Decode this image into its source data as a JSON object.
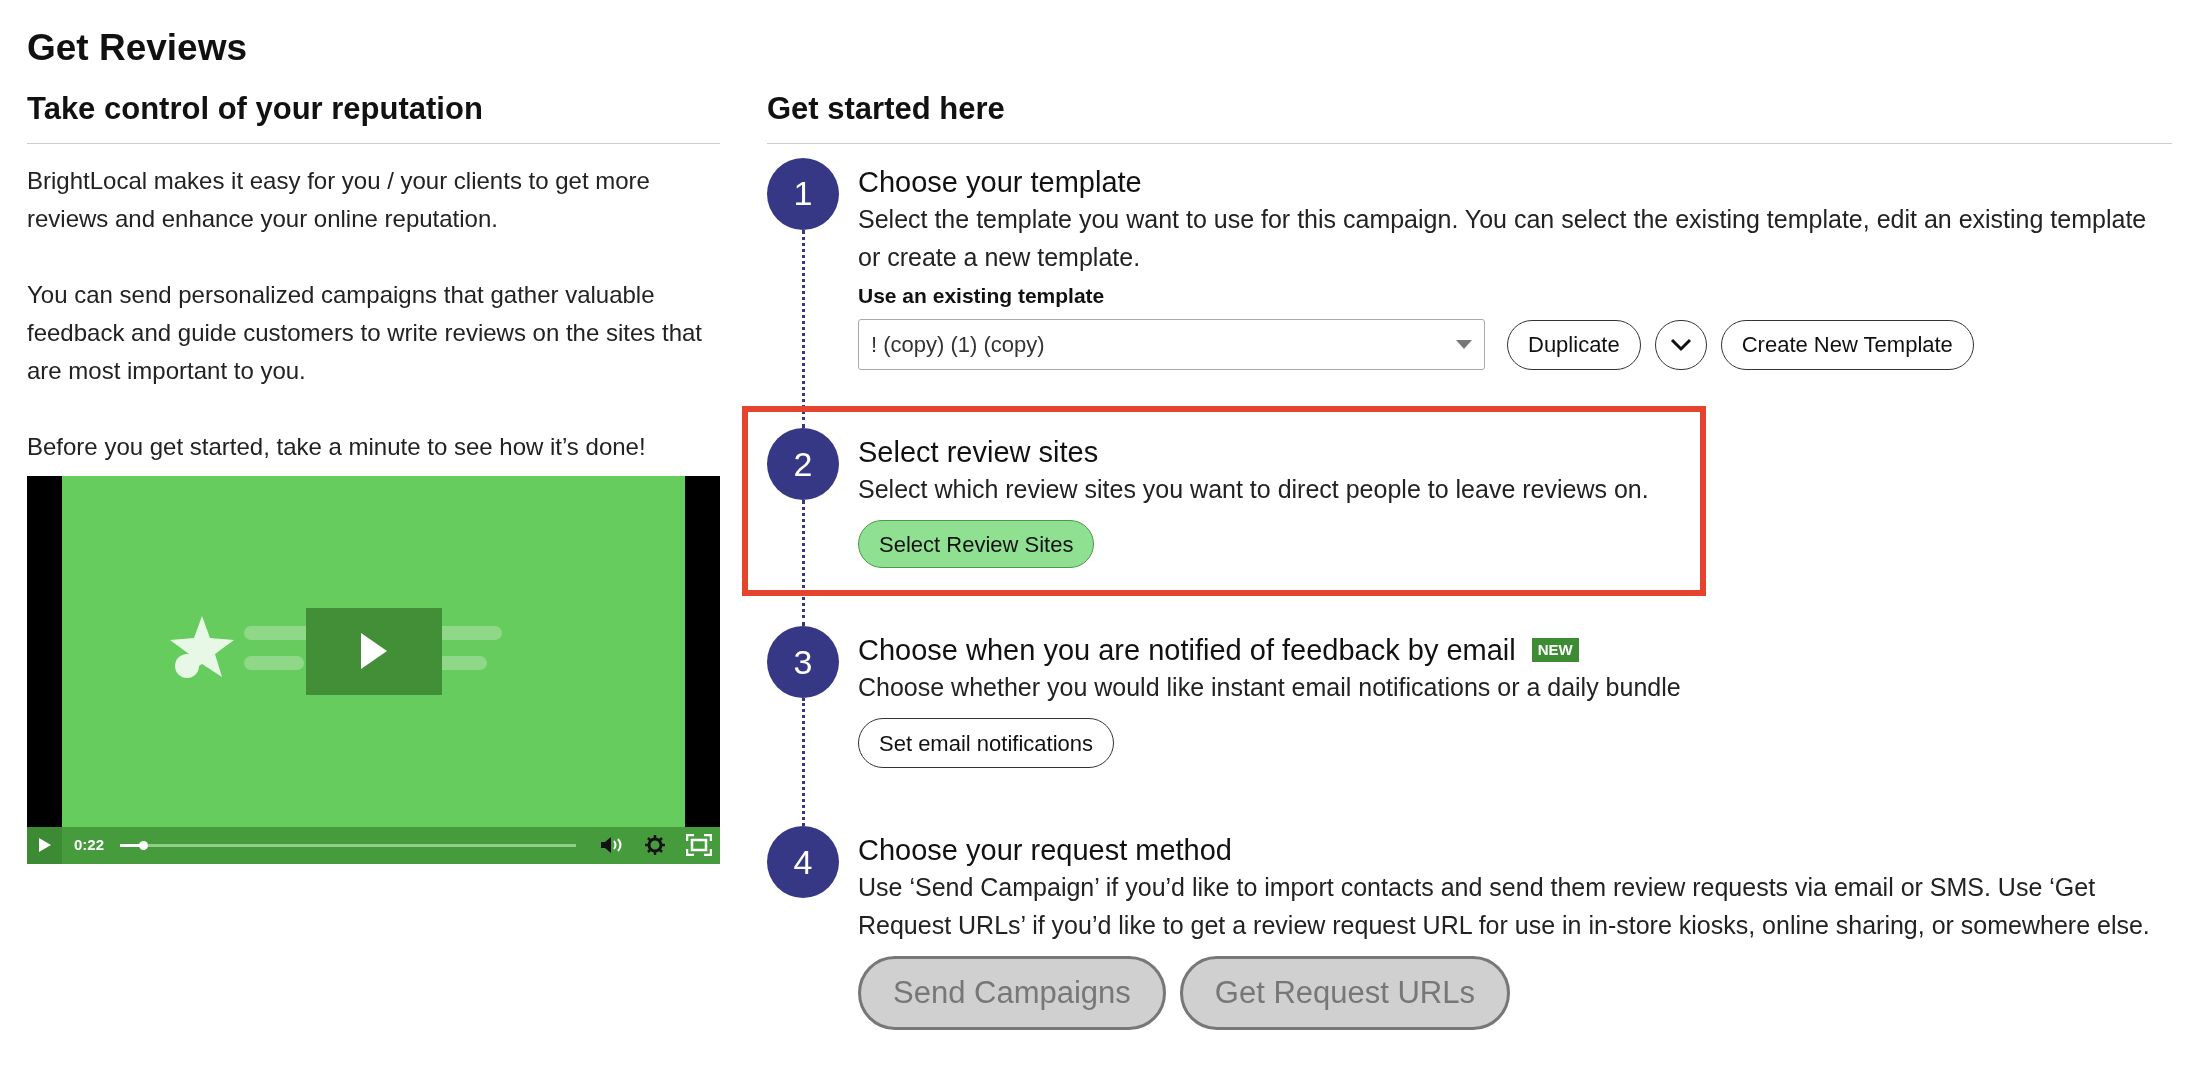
{
  "page_title": "Get Reviews",
  "intro": {
    "heading": "Take control of your reputation",
    "paragraphs": [
      "BrightLocal makes it easy for you / your clients to get more reviews and enhance your online reputation.",
      "You can send personalized campaigns that gather valuable feedback and guide customers to write reviews on the sites that are most important to you.",
      "Before you get started, take a minute to see how it’s done!"
    ],
    "video": {
      "playing": false,
      "elapsed": "0:22",
      "level": 0.05
    }
  },
  "steps_section": {
    "heading": "Get started here",
    "steps": [
      {
        "number": "1",
        "title": "Choose your template",
        "description": "Select the template you want to use for this campaign. You can select the existing template, edit an existing template or create a new template.",
        "highlighted": false,
        "field_label": "Use an existing template",
        "dropdown": {
          "value": "! (copy) (1) (copy)"
        },
        "buttons": [
          {
            "kind": "outline",
            "label": "Duplicate",
            "disabled": false
          },
          {
            "kind": "menu",
            "disabled": false
          },
          {
            "kind": "outline",
            "label": "Create New Template",
            "disabled": false
          }
        ]
      },
      {
        "number": "2",
        "title": "Select review sites",
        "description": "Select which review sites you want to direct people to leave reviews on.",
        "highlighted": true,
        "buttons": [
          {
            "kind": "primary",
            "label": "Select Review Sites",
            "disabled": false
          }
        ]
      },
      {
        "number": "3",
        "title": "Choose when you are notified of feedback by email",
        "badge": "NEW",
        "description": "Choose whether you would like instant email notifications or a daily bundle",
        "highlighted": false,
        "buttons": [
          {
            "kind": "outline",
            "label": "Set email notifications",
            "disabled": false
          }
        ]
      },
      {
        "number": "4",
        "title": "Choose your request method",
        "description": "Use ‘Send Campaign’ if you’d like to import contacts and send them review requests via email or SMS. Use ‘Get Request URLs’ if you’d like to get a review request URL for use in in-store kiosks, online sharing, or somewhere else.",
        "highlighted": false,
        "buttons": [
          {
            "kind": "large",
            "label": "Send Campaigns",
            "disabled": true
          },
          {
            "kind": "large",
            "label": "Get Request URLs",
            "disabled": true
          }
        ]
      }
    ]
  }
}
